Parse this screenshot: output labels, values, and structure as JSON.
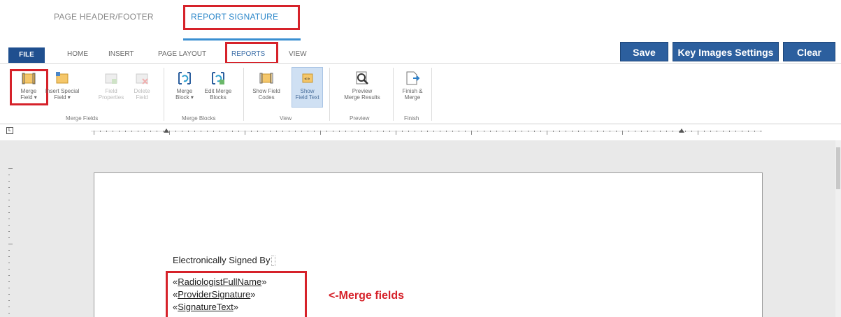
{
  "section_tabs": [
    {
      "label": "PAGE HEADER/FOOTER",
      "active": false
    },
    {
      "label": "REPORT SIGNATURE",
      "active": true
    }
  ],
  "ribbon_tabs": {
    "file": "FILE",
    "home": "HOME",
    "insert": "INSERT",
    "page_layout": "PAGE LAYOUT",
    "reports": "REPORTS",
    "view": "VIEW"
  },
  "actions": {
    "save": "Save",
    "key_images": "Key Images Settings",
    "clear": "Clear"
  },
  "ribbon_groups": {
    "merge_fields": {
      "label": "Merge Fields",
      "merge_field": [
        "Merge",
        "Field ▾"
      ],
      "insert_special": [
        "Insert Special",
        "Field ▾"
      ],
      "field_properties": [
        "Field",
        "Properties"
      ],
      "delete_field": [
        "Delete",
        "Field"
      ]
    },
    "merge_blocks": {
      "label": "Merge Blocks",
      "merge_block": [
        "Merge",
        "Block ▾"
      ],
      "edit_merge_blocks": [
        "Edit Merge",
        "Blocks"
      ]
    },
    "view": {
      "label": "View",
      "show_field_codes": [
        "Show Field",
        "Codes"
      ],
      "show_field_text": [
        "Show",
        "Field Text"
      ]
    },
    "preview": {
      "label": "Preview",
      "preview_merge": [
        "Preview",
        "Merge Results"
      ]
    },
    "finish": {
      "label": "Finish",
      "finish_merge": [
        "Finish &",
        "Merge"
      ]
    }
  },
  "document": {
    "signed_by": "Electronically Signed By",
    "merge_fields": [
      {
        "open": "«",
        "name": "RadiologistFullName",
        "close": "»"
      },
      {
        "open": "«",
        "name": "ProviderSignature",
        "close": "»"
      },
      {
        "open": "«",
        "name": "SignatureText",
        "close": "»"
      }
    ],
    "annotation": "<-Merge fields"
  },
  "colors": {
    "highlight_red": "#d6222a",
    "accent_blue": "#2c5f9e",
    "tab_blue": "#2a86c9"
  }
}
